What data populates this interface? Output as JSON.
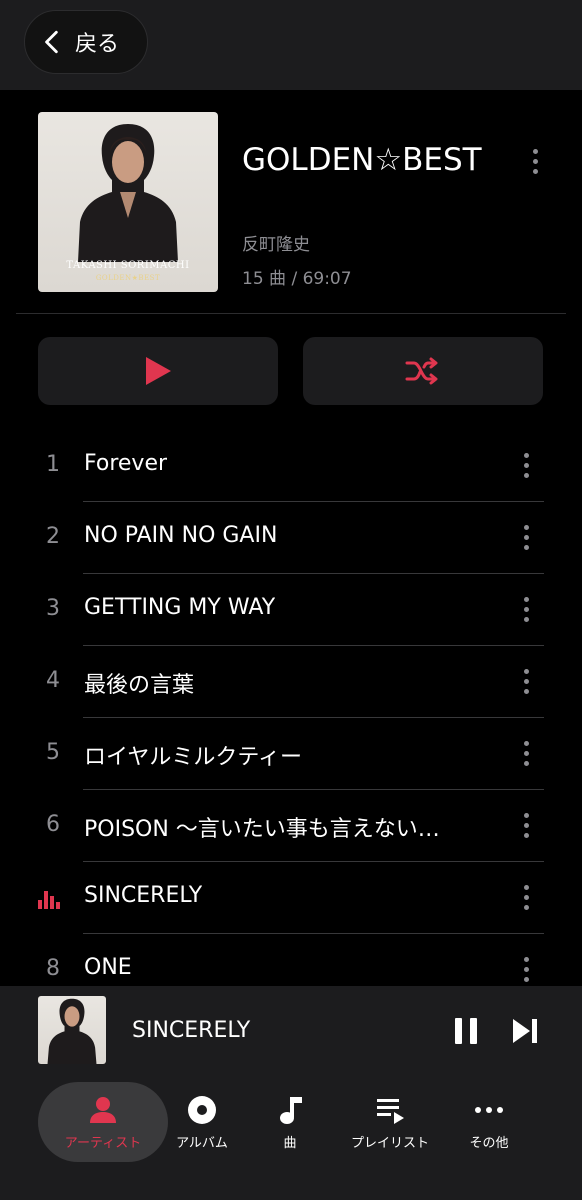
{
  "header": {
    "back_label": "戻る"
  },
  "album": {
    "title": "GOLDEN☆BEST",
    "artist": "反町隆史",
    "meta": "15 曲 / 69:07",
    "cover_line1": "TAKASHI SORIMACHI",
    "cover_line2": "GOLDEN★BEST"
  },
  "tracks": [
    {
      "number": "1",
      "title": "Forever"
    },
    {
      "number": "2",
      "title": "NO PAIN NO GAIN"
    },
    {
      "number": "3",
      "title": "GETTING MY WAY"
    },
    {
      "number": "4",
      "title": "最後の言葉"
    },
    {
      "number": "5",
      "title": "ロイヤルミルクティー"
    },
    {
      "number": "6",
      "title": "POISON 〜言いたい事も言えない…"
    },
    {
      "number": "",
      "title": "SINCERELY",
      "playing": true
    },
    {
      "number": "8",
      "title": "ONE"
    }
  ],
  "now_playing": {
    "title": "SINCERELY"
  },
  "nav": [
    {
      "label": "アーティスト",
      "icon": "person-icon",
      "active": true
    },
    {
      "label": "アルバム",
      "icon": "disc-icon"
    },
    {
      "label": "曲",
      "icon": "music-note-icon"
    },
    {
      "label": "プレイリスト",
      "icon": "playlist-icon"
    },
    {
      "label": "その他",
      "icon": "more-icon"
    }
  ],
  "colors": {
    "accent": "#e0364f",
    "background": "#000000",
    "surface": "#1c1c1e",
    "secondary_text": "#8e8e93"
  }
}
